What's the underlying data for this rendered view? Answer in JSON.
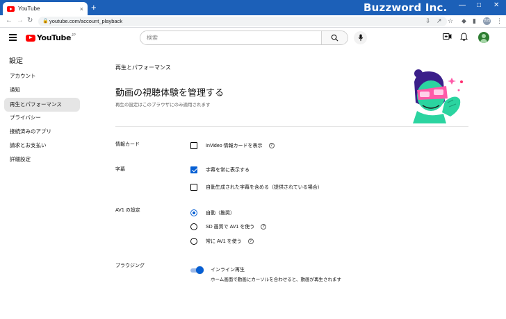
{
  "browser": {
    "tab_title": "YouTube",
    "tab_close": "×",
    "new_tab": "+",
    "url": "youtube.com/account_playback",
    "brand": "Buzzword Inc.",
    "profile_initials": "浩司",
    "icons": [
      "back-icon",
      "forward-icon",
      "reload-icon",
      "lock-icon",
      "install-icon",
      "share-icon",
      "star-icon",
      "extensions-icon",
      "sidepanel-icon",
      "menu-dots-icon",
      "minimize-icon",
      "maximize-icon",
      "close-icon"
    ]
  },
  "youtube": {
    "logo_text": "YouTube",
    "logo_sup": "JP",
    "search_placeholder": "検索",
    "accent": "#065fd4",
    "brand_red": "#ff0000"
  },
  "sidebar": {
    "title": "設定",
    "items": [
      {
        "label": "アカウント",
        "active": false
      },
      {
        "label": "通知",
        "active": false
      },
      {
        "label": "再生とパフォーマンス",
        "active": true
      },
      {
        "label": "プライバシー",
        "active": false
      },
      {
        "label": "接続済みのアプリ",
        "active": false
      },
      {
        "label": "請求とお支払い",
        "active": false
      },
      {
        "label": "詳細設定",
        "active": false
      }
    ]
  },
  "main": {
    "category": "再生とパフォーマンス",
    "title": "動画の視聴体験を管理する",
    "subtitle": "再生の設定はこのブラウザにのみ適用されます",
    "sections": {
      "info_cards": {
        "label": "情報カード",
        "options": [
          {
            "label": "InVideo 情報カードを表示",
            "checked": false,
            "help": "?"
          }
        ]
      },
      "captions": {
        "label": "字幕",
        "options": [
          {
            "label": "字幕を常に表示する",
            "checked": true
          },
          {
            "label": "自動生成された字幕を含める（提供されている場合）",
            "checked": false
          }
        ]
      },
      "av1": {
        "label": "AV1 の設定",
        "options": [
          {
            "label": "自動（推奨）",
            "selected": true
          },
          {
            "label": "SD 画質で AV1 を使う",
            "selected": false,
            "help": "?"
          },
          {
            "label": "常に AV1 を使う",
            "selected": false,
            "help": "?"
          }
        ]
      },
      "browsing": {
        "label": "ブラウジング",
        "toggle_on": true,
        "option_title": "インライン再生",
        "option_desc": "ホーム画面で動画にカーソルを合わせると、動画が再生されます"
      }
    }
  }
}
